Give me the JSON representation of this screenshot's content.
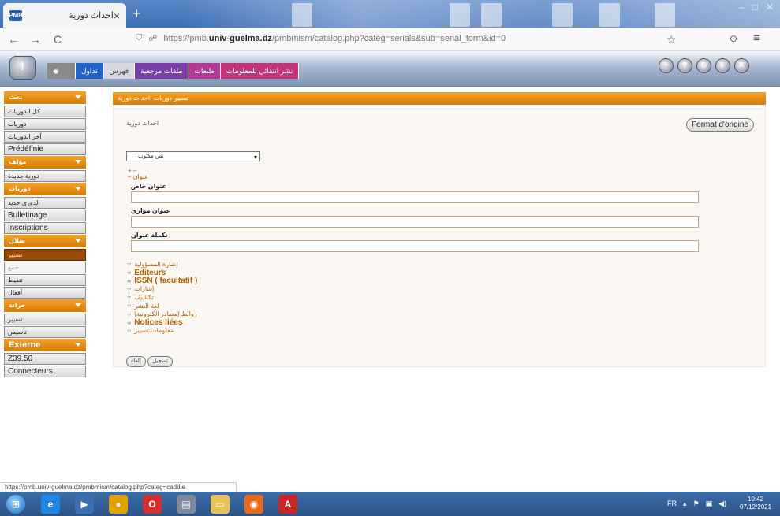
{
  "browser": {
    "tab_title": "احداث دورية",
    "favicon_text": "PMB",
    "tab_close": "×",
    "new_tab": "+",
    "url_prefix": "https://pmb.",
    "url_domain": "univ-guelma.dz",
    "url_suffix": "/pmbmism/catalog.php?categ=serials&sub=serial_form&id=0"
  },
  "icons": {
    "back": "←",
    "forward": "→",
    "reload": "C",
    "shield": "⛉",
    "lock": "🔒",
    "star": "☆",
    "pocket": "⊙",
    "menu": "≡"
  },
  "top_tabs": [
    {
      "label": "تداول",
      "color": "#2563c9"
    },
    {
      "label": "فهرس",
      "color": "#d7d7e4",
      "text": "#444"
    },
    {
      "label": "ملفات مرجعية",
      "color": "#7b3fa8"
    },
    {
      "label": "طبعات",
      "color": "#b03a92"
    },
    {
      "label": "نشر انتقائي للمعلومات",
      "color": "#c0347a"
    }
  ],
  "left_menu": [
    {
      "section": "بحث",
      "items": [
        {
          "label": "كل الدوريات"
        },
        {
          "label": "دوريات"
        },
        {
          "label": "آخر الدوريات"
        },
        {
          "label": "Prédéfinie",
          "big": true
        }
      ]
    },
    {
      "section": "مؤلف",
      "items": [
        {
          "label": "دورية جديدة"
        }
      ]
    },
    {
      "section": "دوريات",
      "items": [
        {
          "label": "الدوري جديد"
        },
        {
          "label": "Bulletinage",
          "big": true
        },
        {
          "label": "Inscriptions",
          "big": true
        }
      ]
    },
    {
      "section": "سلال",
      "items": [
        {
          "label": "تسيير",
          "state": "active"
        },
        {
          "label": "جمع",
          "state": "hover"
        },
        {
          "label": "تنقيط"
        },
        {
          "label": "أفعال"
        }
      ]
    },
    {
      "section": "خزانة",
      "items": [
        {
          "label": "تسيير"
        },
        {
          "label": "تأسيس"
        }
      ]
    },
    {
      "section": "Externe",
      "big": true,
      "items": [
        {
          "label": "Z39.50",
          "big": true
        },
        {
          "label": "Connecteurs",
          "big": true
        }
      ]
    }
  ],
  "main": {
    "header": "تسيير دوريات :احداث دورية",
    "form_title": "احداث دورية",
    "format_button": "Format d'origine",
    "doc_type_selected": "نص مكتوب",
    "expand_all": "+ –",
    "title_group_label": "عنوان",
    "fields": [
      {
        "label": "عنوان خاص"
      },
      {
        "label": "عنوان موازي"
      },
      {
        "label": "تكملة عنوان"
      }
    ],
    "sections": [
      {
        "label": "إشارة المسؤولية",
        "big": false
      },
      {
        "label": "Editeurs",
        "big": true
      },
      {
        "label": "ISSN ( facultatif )",
        "big": true
      },
      {
        "label": "إشارات",
        "big": false
      },
      {
        "label": "تكشيف",
        "big": false
      },
      {
        "label": "لغة النشر",
        "big": false
      },
      {
        "label": "روابط (مصادر الكترونية)",
        "big": false
      },
      {
        "label": "Notices liées",
        "big": true
      },
      {
        "label": "معلومات تسيير",
        "big": false
      }
    ],
    "cancel_button": "إلغاء",
    "save_button": "تسجيل"
  },
  "status_url": "https://pmb.univ-guelma.dz/pmbmism/catalog.php?categ=caddie",
  "taskbar": {
    "lang": "FR",
    "time": "10:42",
    "date": "07/12/2021",
    "apps": [
      {
        "name": "ie",
        "glyph": "e",
        "color": "#1e88e5"
      },
      {
        "name": "media",
        "glyph": "▶",
        "color": "#3c6fb0"
      },
      {
        "name": "chrome",
        "glyph": "●",
        "color": "#e0a100"
      },
      {
        "name": "opera",
        "glyph": "O",
        "color": "#d32f2f"
      },
      {
        "name": "notes",
        "glyph": "▤",
        "color": "#7e8b9c"
      },
      {
        "name": "explorer",
        "glyph": "▭",
        "color": "#e7c15a"
      },
      {
        "name": "firefox",
        "glyph": "◉",
        "color": "#e86a1f"
      },
      {
        "name": "pdf",
        "glyph": "A",
        "color": "#c62828"
      }
    ]
  }
}
